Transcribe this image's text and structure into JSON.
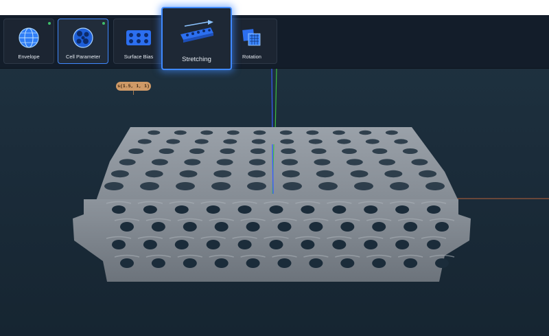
{
  "toolbar": {
    "tools": [
      {
        "label": "Envelope",
        "icon": "globe-icon",
        "indicator": true
      },
      {
        "label": "Cell Parameter",
        "icon": "cell-sphere-icon",
        "indicator": true,
        "selected": true
      },
      {
        "label": "Surface Bias",
        "icon": "surface-bias-icon"
      },
      {
        "label": "Stretching",
        "icon": "stretch-arrow-icon",
        "active": true
      },
      {
        "label": "Rotation",
        "icon": "rotation-cubes-icon"
      }
    ]
  },
  "viewport": {
    "param_label": "s(1.5, 1, 1)",
    "axes": {
      "y_color": "#3fbf3f",
      "z_color": "#3a5cff",
      "x_color": "#c06a3a"
    },
    "model_color": "#8f969e"
  },
  "colors": {
    "accent": "#3f89ff",
    "toolbar_bg": "#131d2a",
    "viewport_bg": "#1b2c3a",
    "indicator": "#3fbf6a",
    "label_bg": "#cf9a67"
  }
}
